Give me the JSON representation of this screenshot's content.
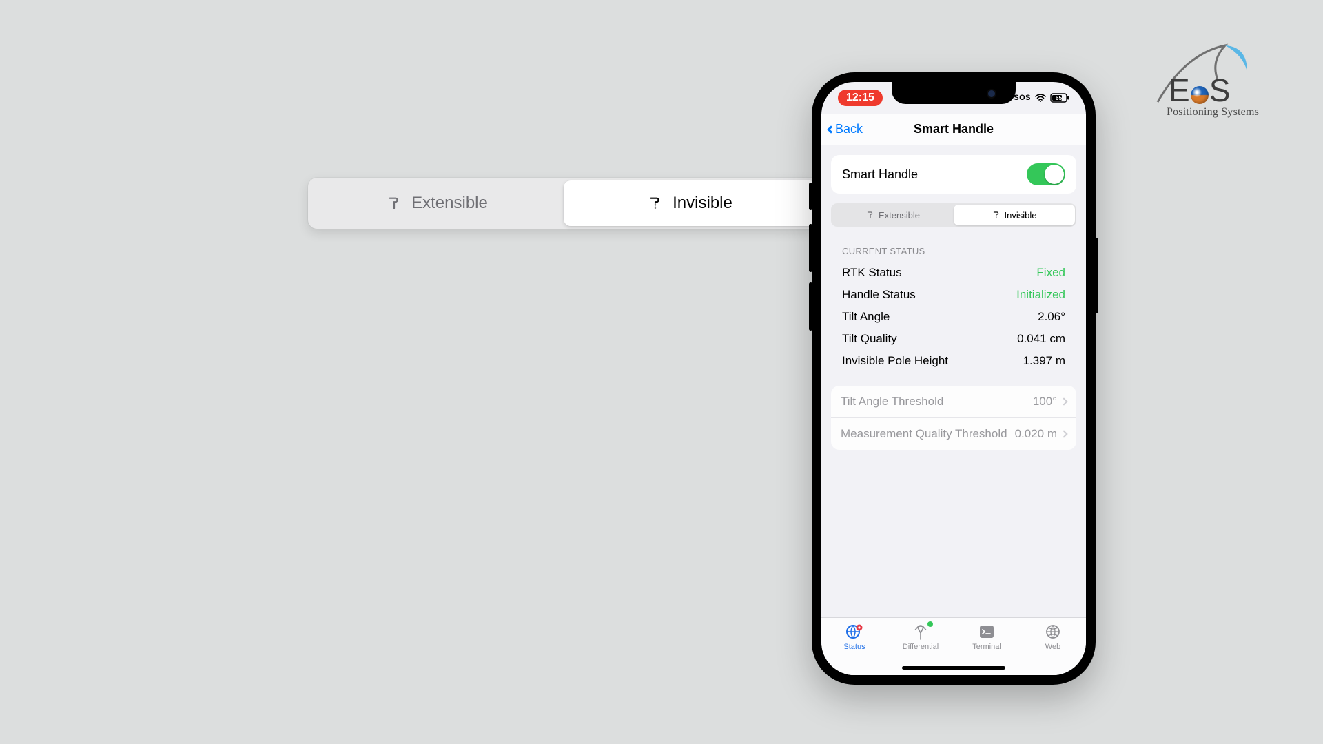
{
  "brand": {
    "name": "EOS",
    "tagline": "Positioning Systems"
  },
  "callout": {
    "options": [
      {
        "label": "Extensible",
        "selected": false
      },
      {
        "label": "Invisible",
        "selected": true
      }
    ]
  },
  "statusbar": {
    "time": "12:15",
    "sos": "SOS"
  },
  "nav": {
    "back": "Back",
    "title": "Smart Handle"
  },
  "toggle_row": {
    "label": "Smart Handle",
    "on": true
  },
  "segmented": {
    "options": [
      {
        "label": "Extensible",
        "selected": false
      },
      {
        "label": "Invisible",
        "selected": true
      }
    ]
  },
  "section_header": "CURRENT STATUS",
  "status": [
    {
      "label": "RTK Status",
      "value": "Fixed",
      "color": "green"
    },
    {
      "label": "Handle Status",
      "value": "Initialized",
      "color": "green"
    },
    {
      "label": "Tilt Angle",
      "value": "2.06°",
      "color": "black"
    },
    {
      "label": "Tilt Quality",
      "value": "0.041 cm",
      "color": "black"
    },
    {
      "label": "Invisible Pole Height",
      "value": "1.397 m",
      "color": "black"
    }
  ],
  "thresholds": [
    {
      "label": "Tilt Angle Threshold",
      "value": "100°"
    },
    {
      "label": "Measurement Quality Threshold",
      "value": "0.020 m"
    }
  ],
  "tabs": [
    {
      "label": "Status",
      "icon": "globe",
      "active": true,
      "badge": false
    },
    {
      "label": "Differential",
      "icon": "antenna",
      "active": false,
      "badge": true
    },
    {
      "label": "Terminal",
      "icon": "terminal",
      "active": false,
      "badge": false
    },
    {
      "label": "Web",
      "icon": "web",
      "active": false,
      "badge": false
    }
  ]
}
